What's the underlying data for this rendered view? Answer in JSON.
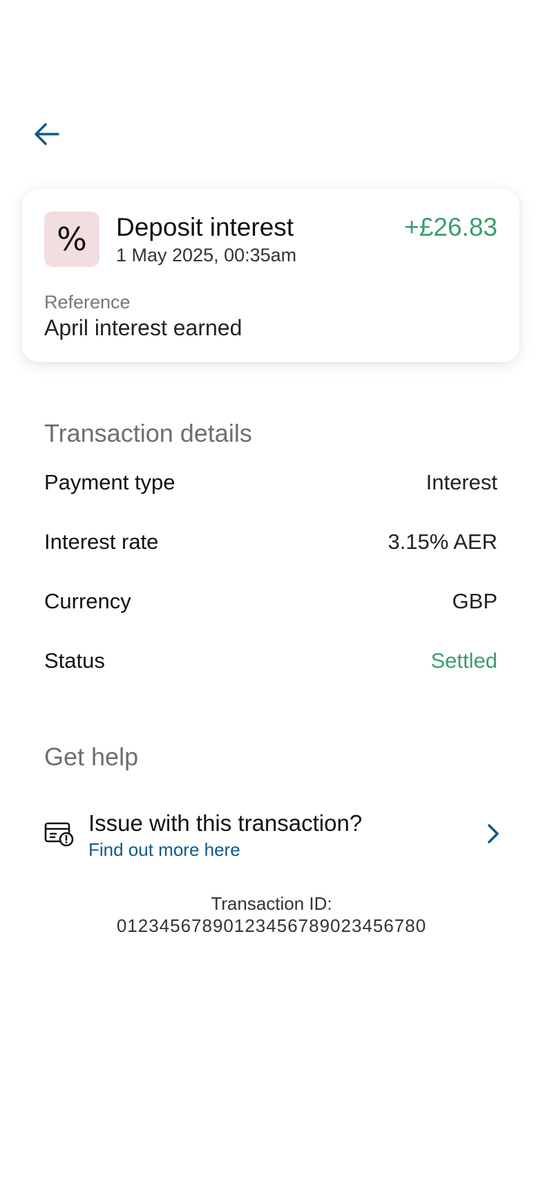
{
  "nav": {
    "back_icon": "arrow-left-icon",
    "accent_color": "#0e5a8a"
  },
  "transaction": {
    "icon_glyph": "%",
    "icon_name": "percent-icon",
    "icon_bg_color": "#f2dde1",
    "title": "Deposit interest",
    "datetime": "1 May 2025, 00:35am",
    "amount": "+£26.83",
    "amount_color": "#3a9e6b",
    "reference_label": "Reference",
    "reference_value": "April interest earned"
  },
  "details": {
    "heading": "Transaction details",
    "rows": [
      {
        "label": "Payment type",
        "value": "Interest"
      },
      {
        "label": "Interest rate",
        "value": "3.15% AER"
      },
      {
        "label": "Currency",
        "value": "GBP"
      },
      {
        "label": "Status",
        "value": "Settled"
      }
    ],
    "status_color": "#3a9e6b"
  },
  "help": {
    "heading": "Get help",
    "icon_name": "card-alert-icon",
    "item_title": "Issue with this transaction?",
    "item_link": "Find out more here",
    "chevron_icon": "chevron-right-icon"
  },
  "footer": {
    "id_label": "Transaction ID:",
    "id_value": "0123456789012345678902345678​0"
  }
}
